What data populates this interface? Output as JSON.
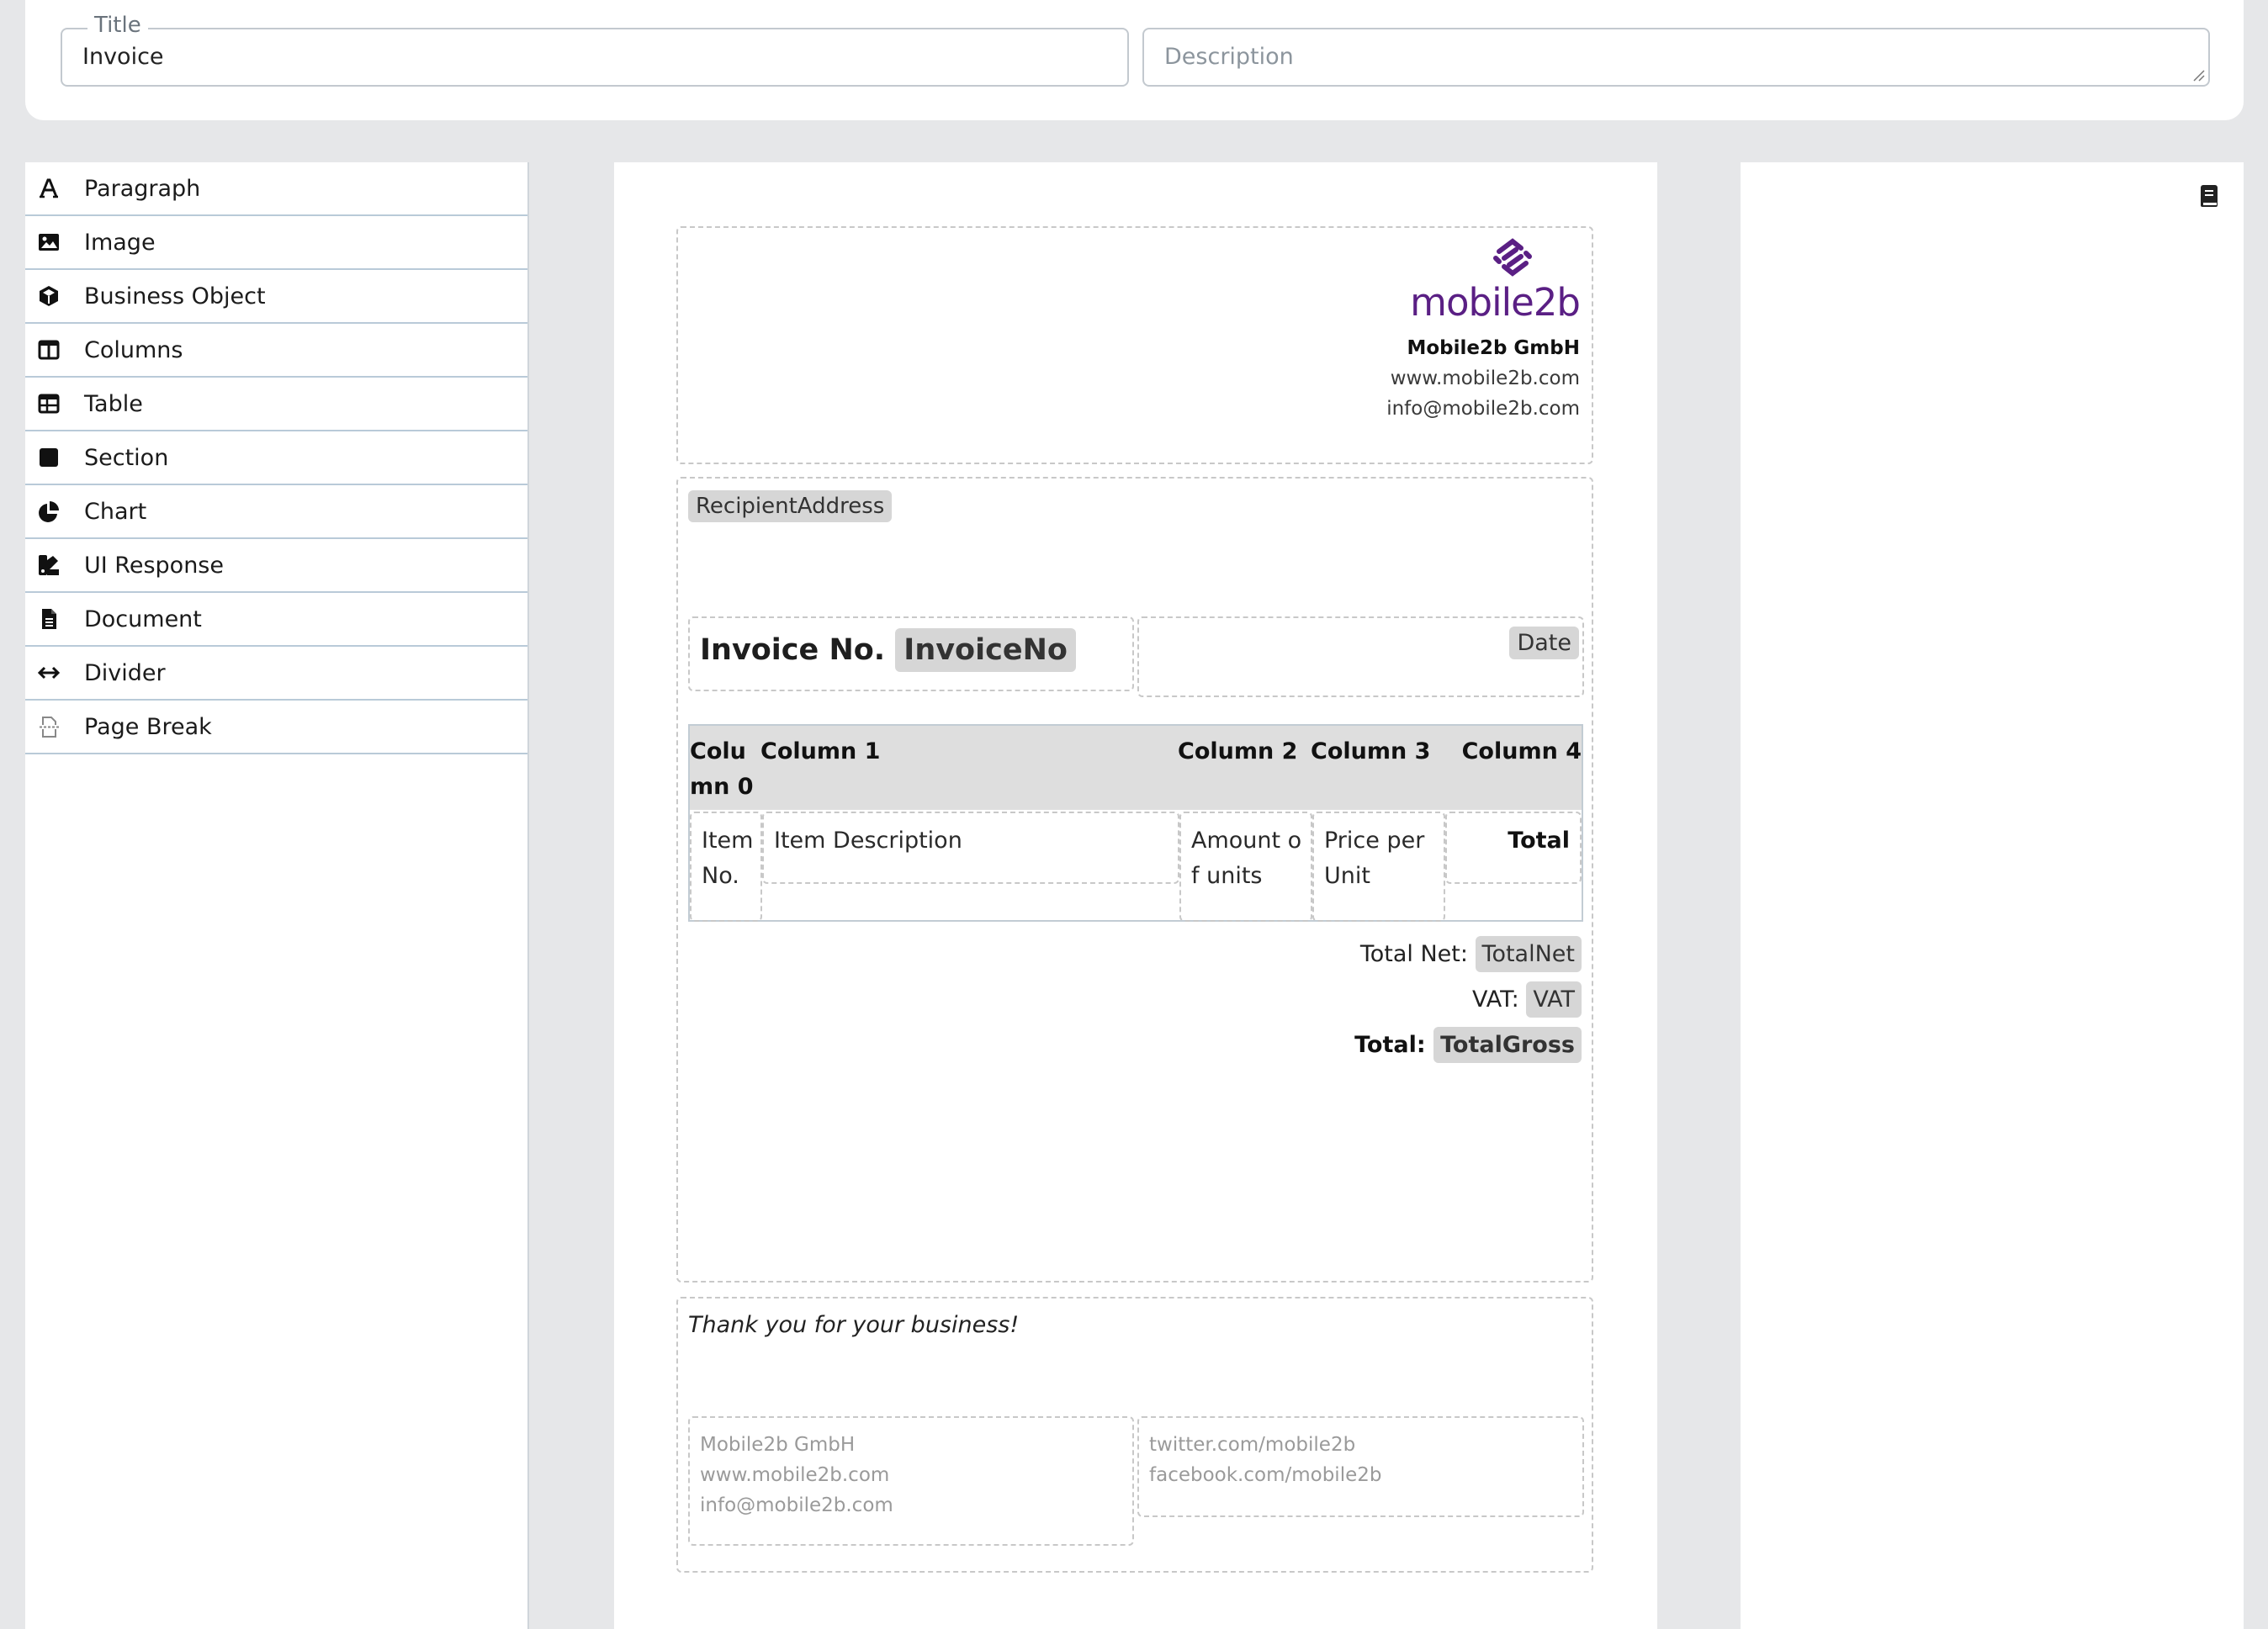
{
  "form": {
    "title_legend": "Title",
    "title_value": "Invoice",
    "description_placeholder": "Description"
  },
  "sidebar": {
    "items": [
      {
        "label": "Paragraph",
        "icon": "font-icon"
      },
      {
        "label": "Image",
        "icon": "image-icon"
      },
      {
        "label": "Business Object",
        "icon": "cube-icon"
      },
      {
        "label": "Columns",
        "icon": "columns-icon"
      },
      {
        "label": "Table",
        "icon": "table-icon"
      },
      {
        "label": "Section",
        "icon": "square-icon"
      },
      {
        "label": "Chart",
        "icon": "pie-chart-icon"
      },
      {
        "label": "UI Response",
        "icon": "ui-response-icon"
      },
      {
        "label": "Document",
        "icon": "file-icon"
      },
      {
        "label": "Divider",
        "icon": "arrows-horizontal-icon"
      },
      {
        "label": "Page Break",
        "icon": "page-break-icon"
      }
    ]
  },
  "document": {
    "header": {
      "logo_text": "mobile2b",
      "company_name": "Mobile2b GmbH",
      "website": "www.mobile2b.com",
      "email": "info@mobile2b.com"
    },
    "recipient_chip": "RecipientAddress",
    "invoice_label": "Invoice No.",
    "invoice_chip": "InvoiceNo",
    "date_chip": "Date",
    "table": {
      "headers": [
        "Colu\nmn 0",
        "Column 1",
        "Column 2",
        "Column 3",
        "Column 4"
      ],
      "row": [
        "Item\nNo.",
        "Item Description",
        "Amount o\nf units",
        "Price per\nUnit",
        "Total"
      ]
    },
    "totals": {
      "net_label": "Total Net:",
      "net_chip": "TotalNet",
      "vat_label": "VAT:",
      "vat_chip": "VAT",
      "gross_label": "Total:",
      "gross_chip": "TotalGross"
    },
    "footer": {
      "thanks": "Thank you for your business!",
      "left_line1": "Mobile2b GmbH",
      "left_line2": "www.mobile2b.com",
      "left_line3": "info@mobile2b.com",
      "right_line1": "twitter.com/mobile2b",
      "right_line2": "facebook.com/mobile2b"
    }
  },
  "right_panel": {
    "icon": "book-icon"
  },
  "colors": {
    "brand": "#5a1f84",
    "chip": "#d6d6d6",
    "table_head": "#dedede",
    "background": "#e6e7e9"
  }
}
